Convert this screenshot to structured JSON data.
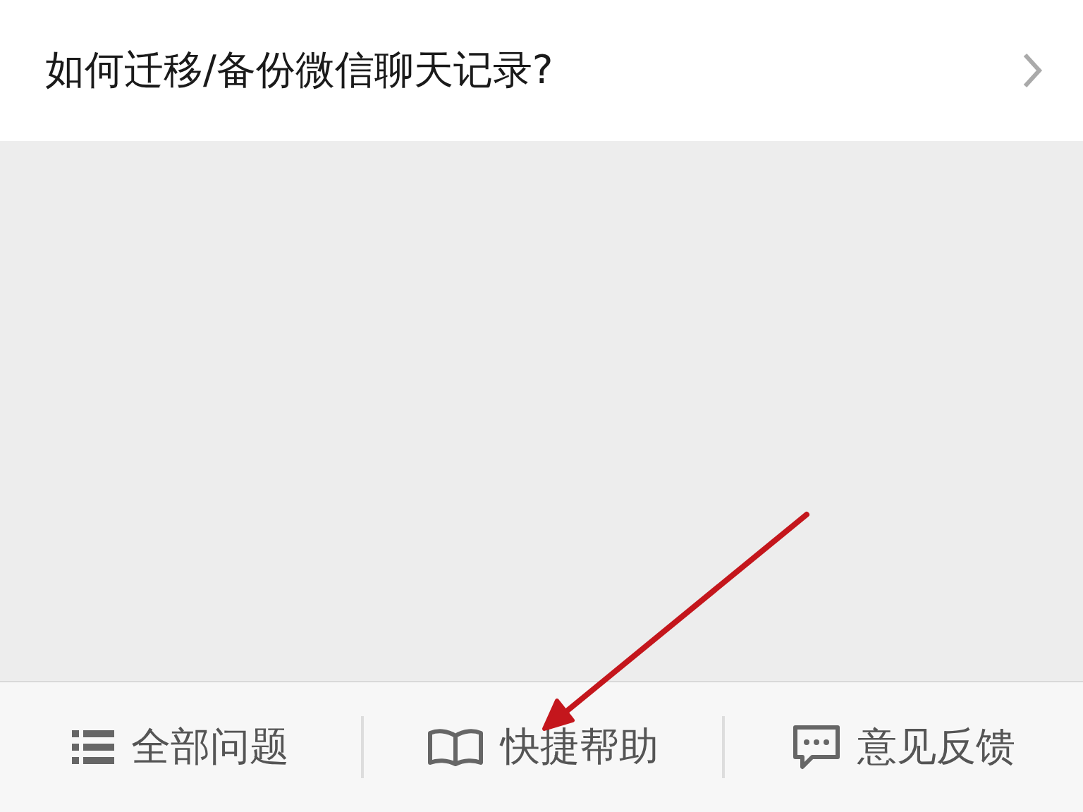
{
  "header": {
    "title": "如何迁移/备份微信聊天记录?"
  },
  "tabs": [
    {
      "kind": "list",
      "label": "全部问题"
    },
    {
      "kind": "book",
      "label": "快捷帮助"
    },
    {
      "kind": "chat",
      "label": "意见反馈"
    }
  ]
}
